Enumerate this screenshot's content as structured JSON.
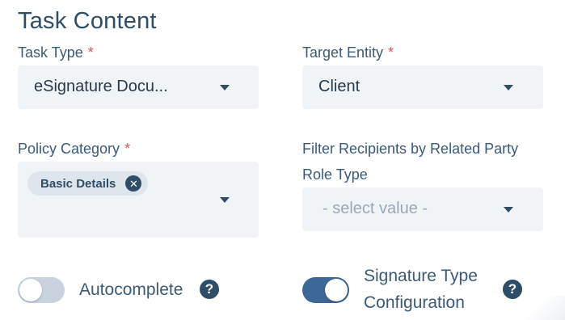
{
  "section_title": "Task Content",
  "required_marker": "*",
  "task_type": {
    "label": "Task Type",
    "value": "eSignature Docu..."
  },
  "target_entity": {
    "label": "Target Entity",
    "value": "Client"
  },
  "policy_category": {
    "label": "Policy Category",
    "chips": [
      {
        "label": "Basic Details",
        "remove_symbol": "✕"
      }
    ]
  },
  "filter_recipients": {
    "label_line1": "Filter Recipients by Related Party",
    "label_line2": "Role Type",
    "placeholder": "- select value -"
  },
  "autocomplete": {
    "label": "Autocomplete",
    "enabled": false,
    "help_symbol": "?"
  },
  "signature_type": {
    "label_line1": "Signature Type",
    "label_line2": "Configuration",
    "enabled": true,
    "help_symbol": "?"
  },
  "colors": {
    "toggle_on": "#3c6796",
    "toggle_off": "#c8d3de",
    "required": "#e15656",
    "field_bg": "#f1f4f7"
  }
}
